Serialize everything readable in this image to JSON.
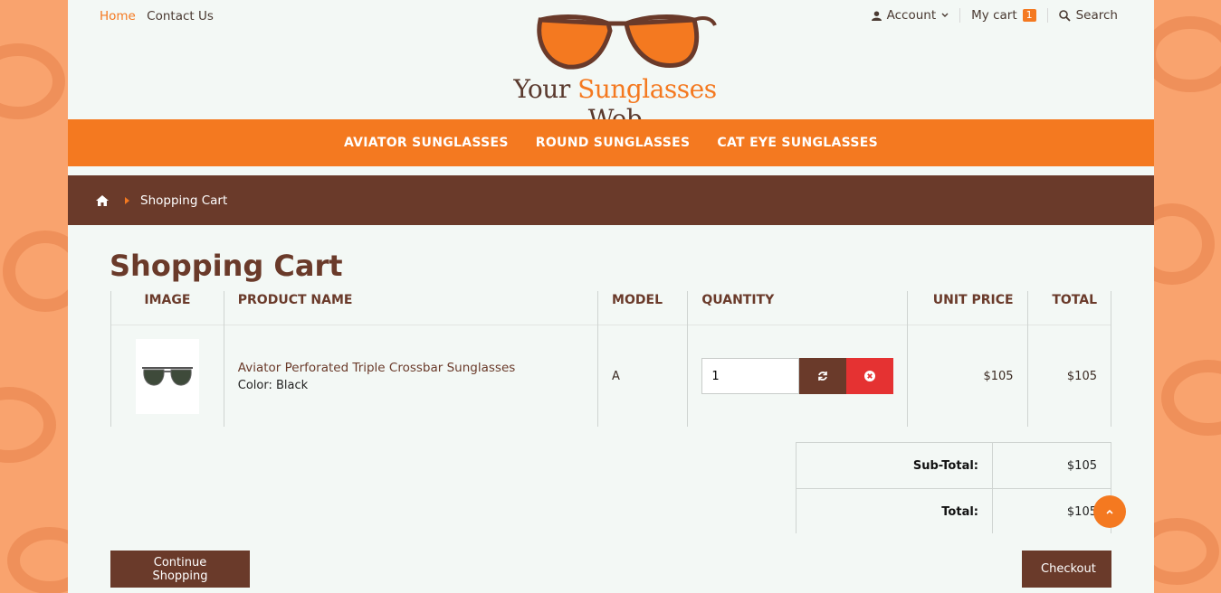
{
  "header": {
    "top_links": {
      "home": "Home",
      "contact": "Contact Us"
    },
    "account_label": "Account",
    "cart_label": "My cart",
    "cart_count": "1",
    "search_label": "Search"
  },
  "logo": {
    "word1": "Your",
    "word2": "Sunglasses",
    "word3": "Web"
  },
  "nav": [
    {
      "label": "AVIATOR SUNGLASSES"
    },
    {
      "label": "ROUND SUNGLASSES"
    },
    {
      "label": "CAT EYE SUNGLASSES"
    }
  ],
  "breadcrumb": {
    "current": "Shopping Cart"
  },
  "page_title": "Shopping Cart",
  "cart": {
    "columns": {
      "image": "IMAGE",
      "name": "PRODUCT NAME",
      "model": "MODEL",
      "quantity": "QUANTITY",
      "unit_price": "UNIT PRICE",
      "total": "TOTAL"
    },
    "items": [
      {
        "name": "Aviator Perforated Triple Crossbar Sunglasses",
        "option": "Color: Black",
        "model": "A",
        "quantity": "1",
        "unit_price": "$105",
        "total": "$105"
      }
    ]
  },
  "totals": {
    "subtotal_label": "Sub-Total:",
    "subtotal_value": "$105",
    "total_label": "Total:",
    "total_value": "$105"
  },
  "buttons": {
    "continue": "Continue Shopping",
    "checkout": "Checkout"
  },
  "colors": {
    "accent": "#f47920",
    "brown": "#6a3a2a",
    "remove_red": "#e53232",
    "background_orange": "#f9a36e"
  },
  "icons": [
    "user-icon",
    "chevron-down-icon",
    "search-icon",
    "home-icon",
    "refresh-icon",
    "remove-icon",
    "arrow-up-icon"
  ]
}
